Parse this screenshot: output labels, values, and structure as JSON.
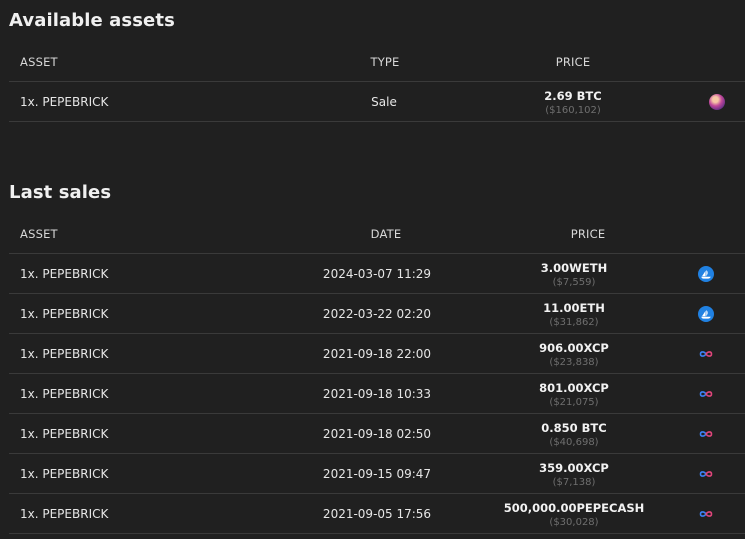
{
  "available": {
    "title": "Available assets",
    "headers": {
      "asset": "ASSET",
      "type": "TYPE",
      "price": "PRICE"
    },
    "rows": [
      {
        "asset": "1x. PEPEBRICK",
        "type": "Sale",
        "price": "2.69 BTC",
        "usd": "($160,102)",
        "icon": "seller-avatar-icon"
      }
    ]
  },
  "sales": {
    "title": "Last sales",
    "headers": {
      "asset": "ASSET",
      "date": "DATE",
      "price": "PRICE"
    },
    "rows": [
      {
        "asset": "1x. PEPEBRICK",
        "date": "2024-03-07 11:29",
        "price": "3.00WETH",
        "usd": "($7,559)",
        "icon": "opensea-icon"
      },
      {
        "asset": "1x. PEPEBRICK",
        "date": "2022-03-22 02:20",
        "price": "11.00ETH",
        "usd": "($31,862)",
        "icon": "opensea-icon"
      },
      {
        "asset": "1x. PEPEBRICK",
        "date": "2021-09-18 22:00",
        "price": "906.00XCP",
        "usd": "($23,838)",
        "icon": "infinity-icon"
      },
      {
        "asset": "1x. PEPEBRICK",
        "date": "2021-09-18 10:33",
        "price": "801.00XCP",
        "usd": "($21,075)",
        "icon": "infinity-icon"
      },
      {
        "asset": "1x. PEPEBRICK",
        "date": "2021-09-18 02:50",
        "price": "0.850 BTC",
        "usd": "($40,698)",
        "icon": "infinity-icon"
      },
      {
        "asset": "1x. PEPEBRICK",
        "date": "2021-09-15 09:47",
        "price": "359.00XCP",
        "usd": "($7,138)",
        "icon": "infinity-icon"
      },
      {
        "asset": "1x. PEPEBRICK",
        "date": "2021-09-05 17:56",
        "price": "500,000.00PEPECASH",
        "usd": "($30,028)",
        "icon": "infinity-icon"
      }
    ]
  },
  "colors": {
    "background": "#202020",
    "opensea": "#2081e2",
    "infinity_a": "#3b82f6",
    "infinity_b": "#e0457b"
  }
}
